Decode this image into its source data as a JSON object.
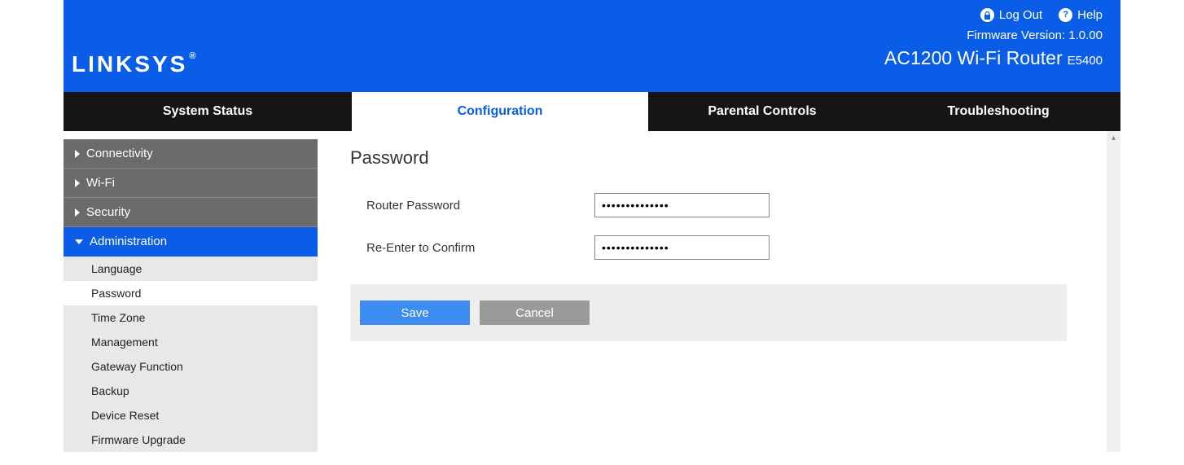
{
  "header": {
    "logout": "Log Out",
    "help": "Help",
    "firmware_label": "Firmware Version:",
    "firmware_version": "1.0.00",
    "product_name": "AC1200 Wi-Fi Router",
    "product_model": "E5400",
    "brand": "LINKSYS"
  },
  "tabs": {
    "system_status": "System Status",
    "configuration": "Configuration",
    "parental_controls": "Parental Controls",
    "troubleshooting": "Troubleshooting"
  },
  "sidebar": {
    "connectivity": "Connectivity",
    "wifi": "Wi-Fi",
    "security": "Security",
    "administration": "Administration",
    "admin_items": {
      "language": "Language",
      "password": "Password",
      "timezone": "Time Zone",
      "management": "Management",
      "gateway": "Gateway Function",
      "backup": "Backup",
      "device_reset": "Device Reset",
      "firmware_upgrade": "Firmware Upgrade"
    }
  },
  "main": {
    "title": "Password",
    "router_password_label": "Router Password",
    "confirm_label": "Re-Enter to Confirm",
    "router_password_value": "••••••••••••••",
    "confirm_value": "••••••••••••••",
    "save": "Save",
    "cancel": "Cancel"
  }
}
